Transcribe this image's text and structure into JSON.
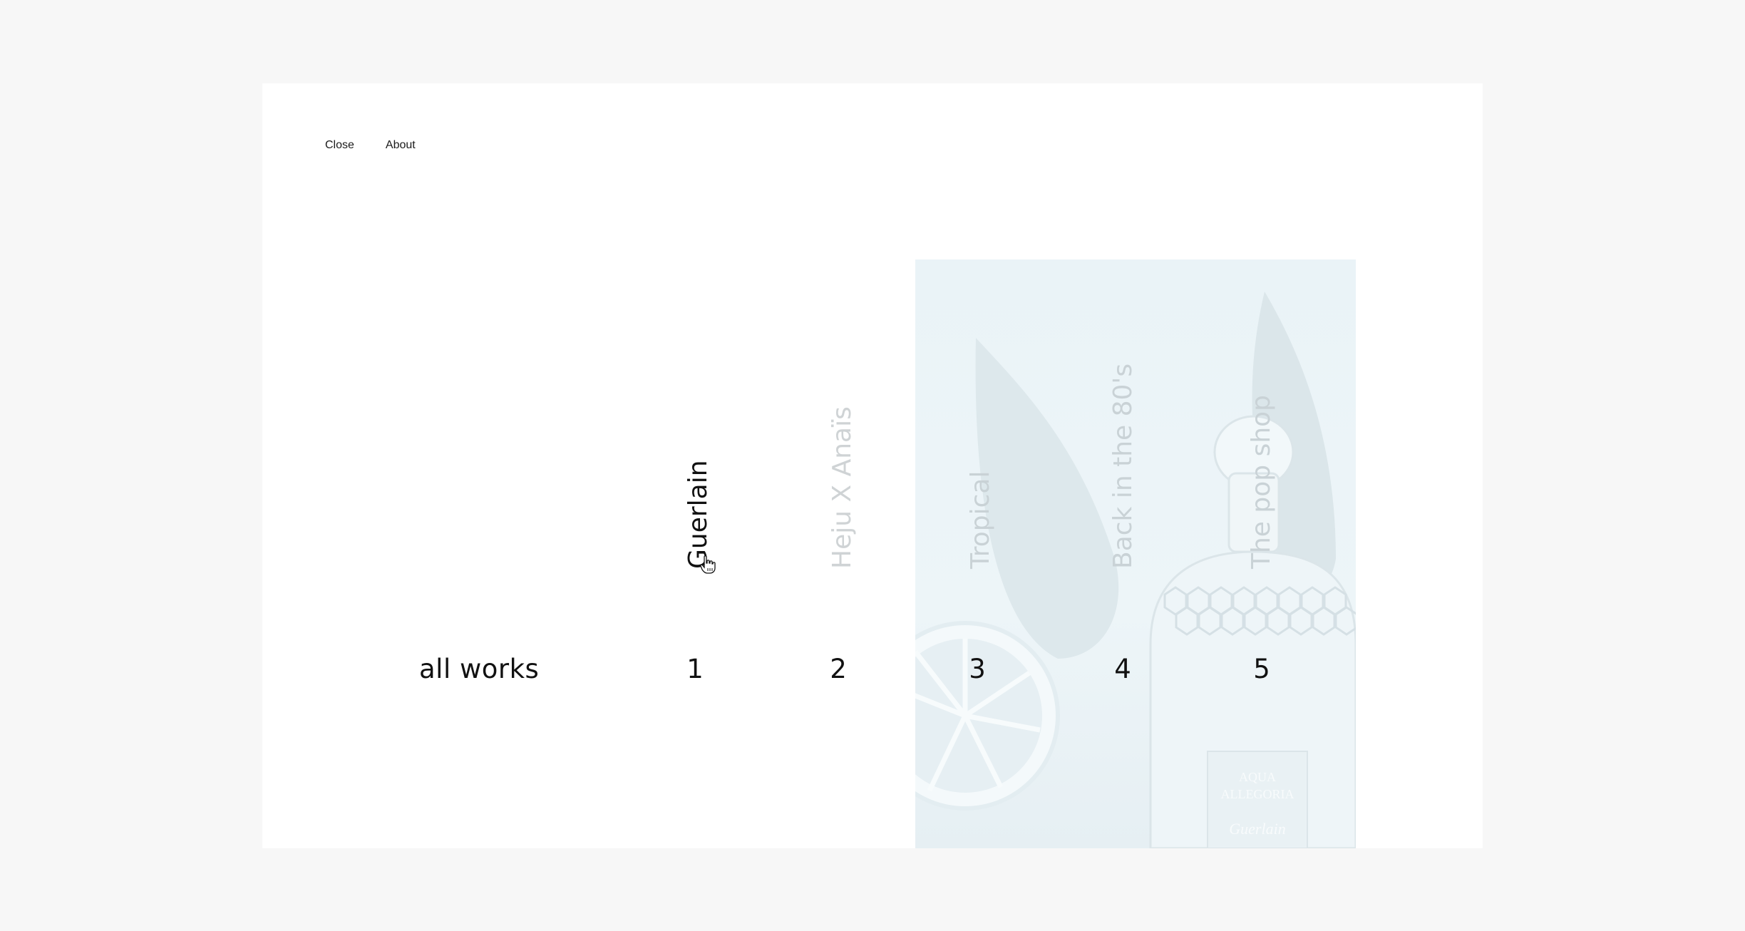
{
  "nav": {
    "close": "Close",
    "about": "About"
  },
  "index": {
    "all_works": "all works"
  },
  "works": [
    {
      "number": "1",
      "title": "Guerlain"
    },
    {
      "number": "2",
      "title": "Heju X Anaïs"
    },
    {
      "number": "3",
      "title": "Tropical"
    },
    {
      "number": "4",
      "title": "Back in the 80's"
    },
    {
      "number": "5",
      "title": "The pop shop"
    }
  ],
  "preview": {
    "bottle_label_line1": "AQUA",
    "bottle_label_line2": "ALLEGORIA",
    "bottle_brand": "Guerlain"
  },
  "colors": {
    "page_bg": "#f7f7f7",
    "frame_bg": "#ffffff",
    "text": "#111111",
    "muted": "#cfd3d5",
    "preview_tint": "#eaf3f7"
  }
}
